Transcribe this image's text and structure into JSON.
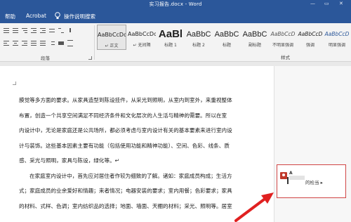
{
  "window": {
    "title": "实习报告.docx  -  Word",
    "controls": [
      "—",
      "▭",
      "✕"
    ]
  },
  "ribbon_tabs": [
    {
      "label": "帮助"
    },
    {
      "label": "Acrobat"
    },
    {
      "label": "操作说明搜索"
    }
  ],
  "groups": {
    "paragraph": "段落",
    "styles": "样式"
  },
  "styles": [
    {
      "sample": "AaBbCcDc",
      "name": "↵ 正文",
      "selected": true
    },
    {
      "sample": "AaBbCcDc",
      "name": "↵ 无间隔"
    },
    {
      "sample": "AaBl",
      "name": "标题 1"
    },
    {
      "sample": "AaBbC",
      "name": "标题 2"
    },
    {
      "sample": "AaBbC",
      "name": "标题"
    },
    {
      "sample": "AaBbC",
      "name": "副标题"
    },
    {
      "sample": "AaBbCcD",
      "name": "不明显强调"
    },
    {
      "sample": "AaBbCcD",
      "name": "强调"
    },
    {
      "sample": "AaBbCcD",
      "name": "明显强调"
    }
  ],
  "document": {
    "lines": [
      {
        "text": "膜觉等多方面的要求。从家具造型到陈设挂件，从采光到照明，从室内到室外，来重视整体"
      },
      {
        "text": "布置，创造一个共享空间满足不同经济条件和文化层次的人生活与精神的需要。所以在室"
      },
      {
        "text": "内设计中，无论是家庭还是公共场所，都必须考虑与室内设计有关的基本要素来进行室内设"
      },
      {
        "text": "计与装饰。这些基本因素主要有功能（包括使用功能和精神功能）、空间、色彩、线条、质"
      },
      {
        "text": "感、采光与照明，家具与陈设，绿化等。↵"
      },
      {
        "text": "在家庭室内设计中，首先应对居住者作较为细致的了解。诸如：家庭成员构成；生活方"
      },
      {
        "text": "式；家庭成员的业余爱好和情趣；来者情况；电器安装的要求；室内用餐；色彩要求；家具"
      },
      {
        "text": "的材料、式样、色调；室内纺织品的选择；地面、墙面、天棚的材料；采光、照明等。居室"
      }
    ]
  },
  "comment": {
    "author": "A",
    "text": "的检当 ▸"
  },
  "colors": {
    "brand": "#2b579a",
    "comment_border": "#d04545",
    "arrow": "#e02020"
  }
}
